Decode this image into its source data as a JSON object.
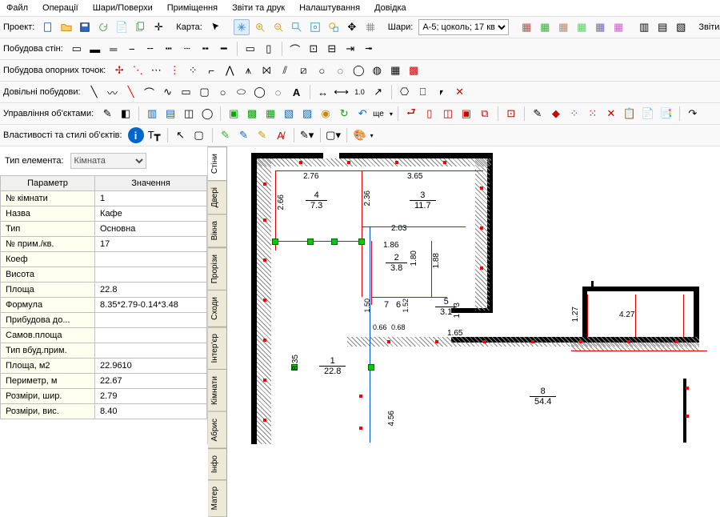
{
  "menu": [
    "Файл",
    "Операції",
    "Шари/Поверхи",
    "Приміщення",
    "Звіти та друк",
    "Налаштування",
    "Довідка"
  ],
  "tb_project": {
    "label": "Проект:"
  },
  "tb_map": {
    "label": "Карта:"
  },
  "tb_layers": {
    "label": "Шари:",
    "value": "А-5; цоколь; 17 кв"
  },
  "tb_reports": {
    "label": "Звіти/Дру"
  },
  "tb_walls": {
    "label": "Побудова стін:"
  },
  "tb_points": {
    "label": "Побудова опорних точок:"
  },
  "tb_free": {
    "label": "Довільні побудови:"
  },
  "tb_objmgr": {
    "label": "Управління об'єктами:"
  },
  "tb_more": {
    "label": "ще"
  },
  "tb_props": {
    "label": "Властивості та стилі об'єктів:"
  },
  "elemtype": {
    "label": "Тип елемента:",
    "value": "Кімната"
  },
  "th": {
    "param": "Параметр",
    "value": "Значення"
  },
  "rows": [
    {
      "p": "№ кімнати",
      "v": "1"
    },
    {
      "p": "Назва",
      "v": "Кафе"
    },
    {
      "p": "Тип",
      "v": "Основна"
    },
    {
      "p": "№ прим./кв.",
      "v": "17"
    },
    {
      "p": "Коеф",
      "v": ""
    },
    {
      "p": "Висота",
      "v": ""
    },
    {
      "p": "Площа",
      "v": "22.8"
    },
    {
      "p": "Формула",
      "v": "8.35*2.79-0.14*3.48"
    },
    {
      "p": "Прибудова до...",
      "v": ""
    },
    {
      "p": "Самов.площа",
      "v": ""
    },
    {
      "p": "Тип вбуд.прим.",
      "v": ""
    },
    {
      "p": "Площа, м2",
      "v": "22.9610"
    },
    {
      "p": "Периметр, м",
      "v": "22.67"
    },
    {
      "p": "Розміри, шир.",
      "v": "2.79"
    },
    {
      "p": "Розміри, вис.",
      "v": "8.40"
    }
  ],
  "vtabs": [
    "Стіни",
    "Двері",
    "Вікна",
    "Прорізи",
    "Сходи",
    "Інтер'єр",
    "Кімнати",
    "Абрис",
    "Інфо",
    "Матер"
  ],
  "dims": {
    "d276": "2.76",
    "d365": "3.65",
    "d266": "2.66",
    "d236": "2.36",
    "d203": "2.03",
    "d186": "1.86",
    "d180": "1.80",
    "d188": "1.88",
    "d150": "1.50",
    "d152": "1.52",
    "d173": "1.73",
    "d066": "0.66",
    "d068": "0.68",
    "d165": "1.65",
    "d835": "8.35",
    "d427": "4.27",
    "d127": "1.27",
    "d456": "4.56"
  },
  "rooms": {
    "r4": {
      "n": "4",
      "a": "7.3"
    },
    "r3": {
      "n": "3",
      "a": "11.7"
    },
    "r2": {
      "n": "2",
      "a": "3.8"
    },
    "r7": {
      "n": "7",
      "a": ""
    },
    "r6": {
      "n": "6",
      "a": ""
    },
    "r5": {
      "n": "5",
      "a": "3.1"
    },
    "r1": {
      "n": "1",
      "a": "22.8"
    },
    "r8": {
      "n": "8",
      "a": "54.4"
    }
  }
}
